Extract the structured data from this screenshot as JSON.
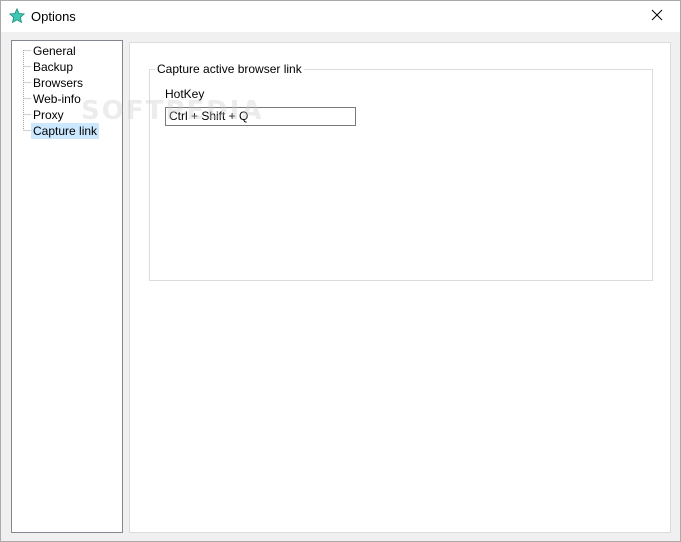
{
  "window": {
    "title": "Options",
    "icon": "star-icon",
    "close": "close-icon"
  },
  "tree": {
    "items": [
      {
        "label": "General",
        "selected": false
      },
      {
        "label": "Backup",
        "selected": false
      },
      {
        "label": "Browsers",
        "selected": false
      },
      {
        "label": "Web-info",
        "selected": false
      },
      {
        "label": "Proxy",
        "selected": false
      },
      {
        "label": "Capture link",
        "selected": true
      }
    ]
  },
  "capture": {
    "group_title": "Capture active browser link",
    "hotkey_label": "HotKey",
    "hotkey_value": "Ctrl + Shift + Q"
  },
  "watermark": "SOFTPEDIA",
  "colors": {
    "selection": "#cce8ff",
    "icon_fill": "#3ec8b4"
  }
}
